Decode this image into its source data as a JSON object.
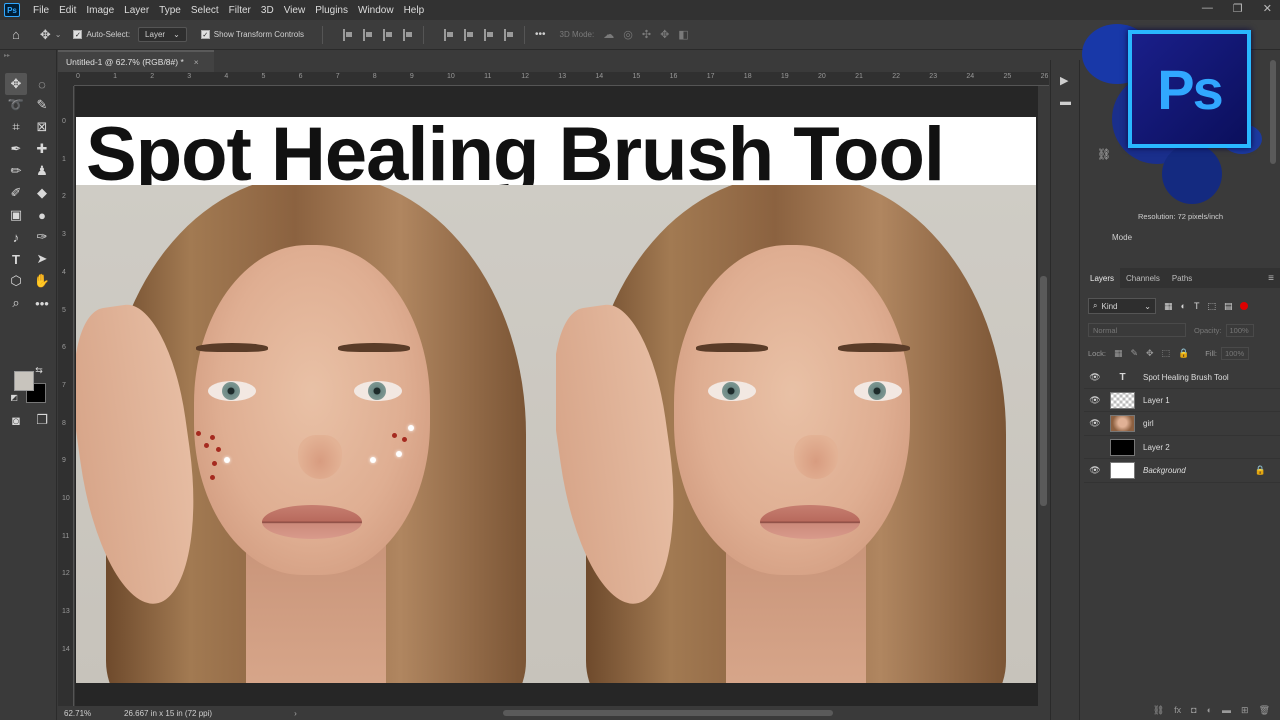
{
  "app": {
    "logo": "Ps"
  },
  "menu": [
    "File",
    "Edit",
    "Image",
    "Layer",
    "Type",
    "Select",
    "Filter",
    "3D",
    "View",
    "Plugins",
    "Window",
    "Help"
  ],
  "window_controls": {
    "minimize": "—",
    "restore": "❐",
    "close": "✕"
  },
  "options_bar": {
    "home_icon": "home-icon",
    "move_icon": "move-icon",
    "auto_select_label": "Auto-Select:",
    "auto_select_value": "Layer",
    "show_transform_label": "Show Transform Controls",
    "more": "•••",
    "mode_3d_label": "3D Mode:"
  },
  "document": {
    "tab_title": "Untitled-1 @ 62.7% (RGB/8#) *",
    "close": "×"
  },
  "ruler_h": [
    "0",
    "1",
    "2",
    "3",
    "4",
    "5",
    "6",
    "7",
    "8",
    "9",
    "10",
    "11",
    "12",
    "13",
    "14",
    "15",
    "16",
    "17",
    "18",
    "19",
    "20",
    "21",
    "22",
    "23",
    "24",
    "25",
    "26"
  ],
  "ruler_v": [
    "0",
    "1",
    "2",
    "3",
    "4",
    "5",
    "6",
    "7",
    "8",
    "9",
    "10",
    "11",
    "12",
    "13",
    "14"
  ],
  "canvas": {
    "title": "Spot Healing Brush Tool"
  },
  "status": {
    "zoom": "62.71%",
    "doc_info": "26.667 in x 15 in (72 ppi)",
    "arrow": "›"
  },
  "properties": {
    "resolution": "Resolution: 72 pixels/inch",
    "mode": "Mode",
    "badge": "Ps"
  },
  "layers_panel": {
    "tabs": [
      "Layers",
      "Channels",
      "Paths"
    ],
    "active_tab": "Layers",
    "menu": "≡",
    "kind_label": "Kind",
    "blend_mode": "Normal",
    "opacity_label": "Opacity:",
    "opacity_value": "100%",
    "lock_label": "Lock:",
    "fill_label": "Fill:",
    "fill_value": "100%",
    "layers": [
      {
        "name": "Spot Healing Brush Tool",
        "visible": true,
        "thumb": "text",
        "thumb_label": "T",
        "italic": false,
        "locked": false
      },
      {
        "name": "Layer 1",
        "visible": true,
        "thumb": "checker",
        "thumb_label": "",
        "italic": false,
        "locked": false
      },
      {
        "name": "girl",
        "visible": true,
        "thumb": "face",
        "thumb_label": "",
        "italic": false,
        "locked": false
      },
      {
        "name": "Layer 2",
        "visible": false,
        "thumb": "black",
        "thumb_label": "",
        "italic": false,
        "locked": false
      },
      {
        "name": "Background",
        "visible": true,
        "thumb": "white",
        "thumb_label": "",
        "italic": true,
        "locked": true
      }
    ],
    "footer_icons": [
      "link-icon",
      "fx-icon",
      "mask-icon",
      "adjustment-icon",
      "group-icon",
      "new-layer-icon",
      "trash-icon"
    ]
  },
  "colors": {
    "foreground": "#c8c4bd",
    "background": "#000000",
    "accent": "#31a8ff"
  }
}
